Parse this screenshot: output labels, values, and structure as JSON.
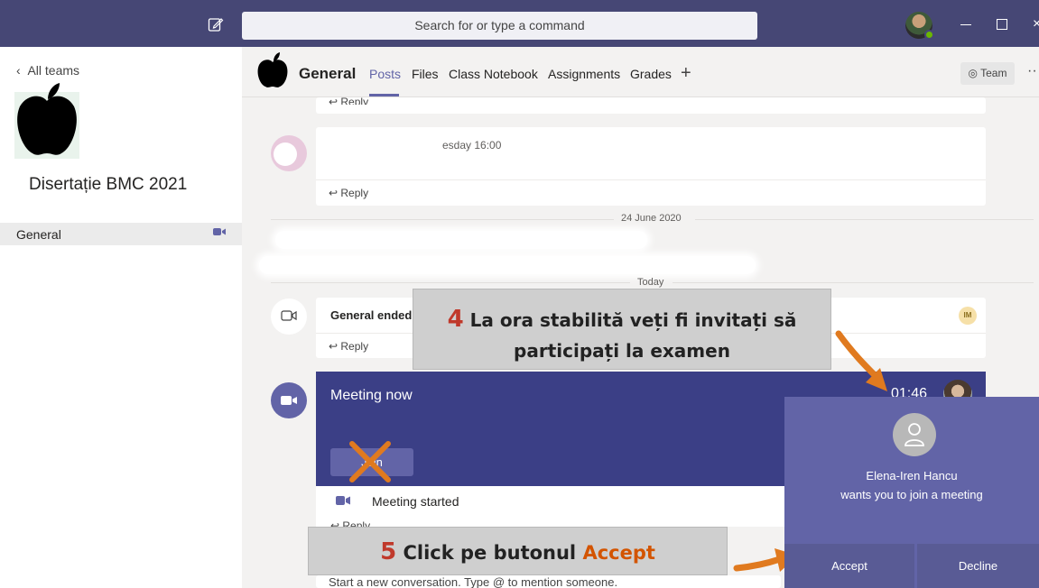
{
  "topbar": {
    "search_placeholder": "Search for or type a command",
    "compose_icon": "compose-icon",
    "window_controls": {
      "close_glyph": "×"
    }
  },
  "left_panel": {
    "back_label": "All teams",
    "team_name": "Disertație BMC 2021",
    "channels": [
      {
        "label": "General",
        "icon": "video-camera-icon"
      }
    ]
  },
  "header": {
    "channel_title": "General",
    "tabs": [
      {
        "label": "Posts",
        "active": true
      },
      {
        "label": "Files"
      },
      {
        "label": "Class Notebook"
      },
      {
        "label": "Assignments"
      },
      {
        "label": "Grades"
      }
    ],
    "add_tab_glyph": "+",
    "team_button_label": "Team",
    "more_glyph": "··"
  },
  "feed": {
    "reply_label": "Reply",
    "message1_time": "esday 16:00",
    "date_separator_1": "24 June 2020",
    "date_separator_2": "Today",
    "ended_text": "General ended:",
    "ended_badge": "IM",
    "meeting": {
      "title": "Meeting now",
      "timer": "01:46",
      "join_label": "Join",
      "started_text": "Meeting started",
      "reply_label": "Reply"
    },
    "compose_placeholder": "Start a new conversation. Type @ to mention someone."
  },
  "annotations": {
    "step4_number": "4",
    "step4_line1": "La ora stabilită veți fi invitați să",
    "step4_line2": "participați la examen",
    "step5_number": "5",
    "step5_text": "Click pe butonul",
    "step5_accent": "Accept"
  },
  "notification": {
    "caller_name": "Elena-Iren Hancu",
    "message": "wants you to join a meeting",
    "accept_label": "Accept",
    "decline_label": "Decline"
  },
  "colors": {
    "topbar": "#464775",
    "accent": "#6264a7",
    "meeting_card": "#3b3f86",
    "arrow": "#e07a1f",
    "step_number": "#c0392b"
  }
}
